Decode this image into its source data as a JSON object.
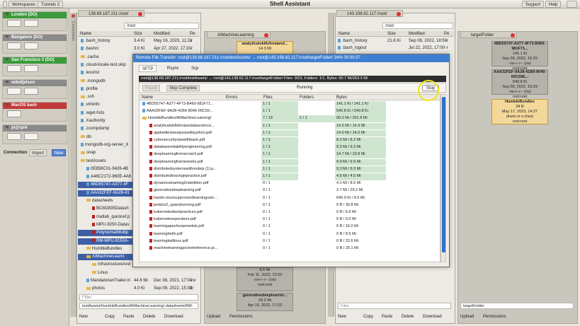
{
  "app": {
    "title": "Shell Assistant",
    "menu": [
      "Workspaces",
      "Tunnels 2"
    ],
    "right_menu": [
      "Support",
      "Help"
    ]
  },
  "connections": [
    {
      "name": "London (DO)",
      "color": "#3b9a3b"
    },
    {
      "name": "Bangalore (DO)",
      "color": "#8a8a8a"
    },
    {
      "name": "San Francisco 3 (DO)",
      "color": "#3b9a3b"
    },
    {
      "name": "mikefjetson",
      "color": "#8a8a8a"
    },
    {
      "name": "MacOS bash",
      "color": "#c23a3a"
    },
    {
      "name": "pi@rpi4",
      "color": "#8a8a8a"
    }
  ],
  "connection_bar": {
    "label": "Connection",
    "import": "Import",
    "new": "New"
  },
  "vertical_tab": "Connections",
  "left_panel": {
    "tab": "138.68.187.211:/root/",
    "path": "/root",
    "columns": [
      "Name",
      "Size",
      "Modified",
      "Pe"
    ],
    "rows": [
      {
        "name": ".bash_history",
        "size": "3.4 Ki",
        "mod": "May 16, 2023, 11:21",
        "pe": "-r",
        "type": "file"
      },
      {
        "name": ".bashrc",
        "size": "3.0 Ki",
        "mod": "Apr 27, 2022, 17:20",
        "pe": "-r",
        "type": "file"
      },
      {
        "name": ".cache",
        "size": "",
        "mod": "",
        "pe": "",
        "type": "folder"
      },
      {
        "name": ".cloud-locale-test.skip",
        "size": "",
        "mod": "",
        "pe": "",
        "type": "file"
      },
      {
        "name": ".lesshst",
        "size": "",
        "mod": "",
        "pe": "",
        "type": "file"
      },
      {
        "name": ".mongodb",
        "size": "",
        "mod": "",
        "pe": "",
        "type": "folder"
      },
      {
        "name": ".profile",
        "size": "",
        "mod": "",
        "pe": "",
        "type": "file"
      },
      {
        "name": ".ssh",
        "size": "",
        "mod": "",
        "pe": "",
        "type": "folder"
      },
      {
        "name": ".viminfo",
        "size": "",
        "mod": "",
        "pe": "",
        "type": "file"
      },
      {
        "name": ".wget-hsts",
        "size": "",
        "mod": "",
        "pe": "",
        "type": "file"
      },
      {
        "name": ".Xauthority",
        "size": "",
        "mod": "",
        "pe": "",
        "type": "file"
      },
      {
        "name": ".zcompdump",
        "size": "",
        "mod": "",
        "pe": "",
        "type": "file"
      },
      {
        "name": "db",
        "size": "",
        "mod": "",
        "pe": "",
        "type": "folder"
      },
      {
        "name": "mongodb-org-server_6",
        "size": "",
        "mod": "",
        "pe": "",
        "type": "file"
      },
      {
        "name": "snap",
        "size": "",
        "mod": "",
        "pe": "",
        "type": "folder"
      },
      {
        "name": "testAssets",
        "size": "",
        "mod": "",
        "pe": "",
        "type": "folder"
      },
      {
        "name": "0E858C01-9426-4B",
        "size": "",
        "mod": "",
        "pe": "",
        "type": "file"
      },
      {
        "name": "A48C2172-860E-4A6",
        "size": "",
        "mod": "",
        "pe": "",
        "type": "file"
      },
      {
        "name": "4BD55747-A377-4F",
        "size": "",
        "mod": "",
        "pe": "",
        "type": "file"
      },
      {
        "name": "AAA32FEF-9A28-41",
        "size": "",
        "mod": "",
        "pe": "",
        "type": "file"
      },
      {
        "name": "datasheets",
        "size": "",
        "mod": "",
        "pe": "",
        "type": "folder"
      },
      {
        "name": "BCM2835Datash",
        "size": "",
        "mod": "",
        "pe": "",
        "type": "pdf"
      },
      {
        "name": "matlab_quickref.p",
        "size": "",
        "mod": "",
        "pe": "",
        "type": "pdf"
      },
      {
        "name": "MPU-9250-Datas",
        "size": "",
        "mod": "",
        "pe": "",
        "type": "pdf"
      },
      {
        "name": "PolynomialMultip",
        "size": "",
        "mod": "",
        "pe": "",
        "type": "pdf"
      },
      {
        "name": "RM-MPU-9150A-",
        "size": "",
        "mod": "",
        "pe": "",
        "type": "pdf"
      },
      {
        "name": "HumbleBundles",
        "size": "",
        "mod": "",
        "pe": "",
        "type": "folder"
      },
      {
        "name": "AIMachineLearni",
        "size": "",
        "mod": "",
        "pe": "",
        "type": "folder"
      },
      {
        "name": "InfrastructureAnd",
        "size": "",
        "mod": "",
        "pe": "",
        "type": "folder"
      },
      {
        "name": "Linux",
        "size": "",
        "mod": "",
        "pe": "",
        "type": "folder"
      },
      {
        "name": "MandalorianTrailer.m",
        "size": "44.6 Mi",
        "mod": "Dec 08, 2021, 17:00",
        "pe": "-rw",
        "type": "file"
      },
      {
        "name": "photos",
        "size": "4.0 Ki",
        "mod": "Sep 09, 2022, 15:31",
        "pe": "dr",
        "type": "folder"
      }
    ],
    "filter_placeholder": "Filter",
    "status": "testAssets/HumbleBundles/AIMachineLearning/.datasheets/RM-",
    "buttons": [
      "New",
      "Copy",
      "Paste",
      "Delete",
      "Download",
      "Upload",
      "Permissions"
    ]
  },
  "middle_panel": {
    "tab": "AIMachineLearning",
    "cards": [
      {
        "name": "analyticalskillsforaiand...",
        "size": "14.3 Mi"
      },
      {
        "name": "",
        "size": "8.5 Mi",
        "date": "Feb 11, 2022, 23:20",
        "perms": "-rw-r--r-- (rw)",
        "owner": "root:root"
      },
      {
        "name": "generativedeeplearnin...",
        "size": "29.2 Mi",
        "date": "Apr 16, 2022, 17:23",
        "perms": "",
        "owner": ""
      }
    ]
  },
  "right_panel": {
    "tab": "143.198.62.117:/root/",
    "path": "/root",
    "columns": [
      "Name",
      "Size",
      "Modified",
      "Pe"
    ],
    "rows": [
      {
        "name": ".bash_history",
        "size": "21.6 Ki",
        "mod": "Sep 08, 2022, 18:50",
        "pe": "-r",
        "type": "file"
      },
      {
        "name": ".bash_logout",
        "size": "",
        "mod": "Jul 22, 2022, 17:00",
        "pe": "-r",
        "type": "file"
      }
    ],
    "target_tab": "targetFolder",
    "target_cards": [
      {
        "name": "4BD55747-A377-4F73-B460-981F71...",
        "size": "141.1 Ki",
        "date": "Sep 09, 2022, 15:29",
        "perms": "-rw-r--r-- (rw)",
        "owner": "root:root"
      },
      {
        "name": "AAA32FEF-9A28-41B9-8040-00C59E...",
        "size": "540.8 Ki",
        "date": "Sep 09, 2022, 15:29",
        "perms": "-rw-r--r-- (rw)",
        "owner": "root:root"
      },
      {
        "name": "HumbleBundles",
        "size": "34 B",
        "date": "May 17, 2023, 14:27",
        "perms": "drwxr-xr-x (rwx)",
        "owner": "root:root"
      }
    ],
    "filter_placeholder": "Filter",
    "target_field": "targetFolder",
    "buttons": [
      "New",
      "Copy",
      "Paste",
      "Delete",
      "Download",
      "Upload",
      "Permissions"
    ]
  },
  "dialog": {
    "title": "Remote File Transfer: root@138.68.187.211:/root/testAssets/ → root@143.198.62.117:/root/targetFolder/ 34% 00:00:37",
    "tabs": [
      "SFTP",
      "Rsync",
      "Scp"
    ],
    "banner": "root@138.68.187.211:/root/testAssets/ → root@143.198.62.117:/root/targetFolder/ Files: 9/23, Folders: 1/1, Bytes: 90.7 Mi/263.3 Mi",
    "pause": "Pause",
    "skip": "Skip Complete",
    "state": "Running",
    "stop": "Stop",
    "columns": [
      "Name",
      "Errors",
      "Files",
      "Folders",
      "Bytes"
    ],
    "rows": [
      {
        "name": "4BD55747-A377-4F73-B460-981F71...",
        "files": "1 / 1",
        "folders": "",
        "bytes": "141.1 Ki / 141.1 Ki",
        "type": "file",
        "indent": 1,
        "done": true
      },
      {
        "name": "AAA32FEF-9A28-41B9-8040-00C59...",
        "files": "1 / 1",
        "folders": "",
        "bytes": "540.8 Ki / 540.8 Ki",
        "type": "file",
        "indent": 1,
        "done": true
      },
      {
        "name": "HumbleBundles/AIMachineLearning/",
        "files": "7 / 19",
        "folders": "1 / 1",
        "bytes": "90.0 Mi / 261.8 Mi",
        "type": "folder",
        "indent": 1,
        "done": true
      },
      {
        "name": "analyticalskillsforaiandatascience...",
        "files": "1 / 1",
        "folders": "",
        "bytes": "14.3 Mi / 14.3 Mi",
        "type": "pdf",
        "indent": 2,
        "done": true
      },
      {
        "name": "appliedtextanalysiswithpython.pdf",
        "files": "1 / 1",
        "folders": "",
        "bytes": "14.0 Mi / 14.0 Mi",
        "type": "pdf",
        "indent": 2,
        "done": true
      },
      {
        "name": "cybersecurityopswithbash.pdf",
        "files": "1 / 1",
        "folders": "",
        "bytes": "8.2 Mi / 8.2 Mi",
        "type": "pdf",
        "indent": 2,
        "done": true
      },
      {
        "name": "databasereliabilityengineering.pdf",
        "files": "1 / 1",
        "folders": "",
        "bytes": "9.3 Mi / 9.3 Mi",
        "type": "pdf",
        "indent": 2,
        "done": true
      },
      {
        "name": "deeplearningfromscratch.pdf",
        "files": "1 / 1",
        "folders": "",
        "bytes": "14.7 Mi / 23.8 Mi",
        "type": "pdf",
        "indent": 2,
        "done": true
      },
      {
        "name": "deeplearningframeworks.pdf",
        "files": "1 / 1",
        "folders": "",
        "bytes": "9.9 Mi / 9.9 Mi",
        "type": "pdf",
        "indent": 2,
        "done": true
      },
      {
        "name": "distributedsystemswithnodejs (1).p...",
        "files": "1 / 1",
        "folders": "",
        "bytes": "9.3 Mi / 9.3 Mi",
        "type": "pdf",
        "indent": 2,
        "done": true
      },
      {
        "name": "distributedtracinginpractice.pdf",
        "files": "1 / 1",
        "folders": "",
        "bytes": "4.5 Mi / 4.5 Mi",
        "type": "pdf",
        "indent": 2,
        "done": true
      },
      {
        "name": "dynamicsteaming2ndedition.pdf",
        "files": "0 / 1",
        "folders": "",
        "bytes": "4.1 Mi / 8.5 Mi",
        "type": "pdf",
        "indent": 2,
        "done": false
      },
      {
        "name": "generativedeeplearning.pdf",
        "files": "0 / 1",
        "folders": "",
        "bytes": "2.7 Mi / 29.2 Mi",
        "type": "pdf",
        "indent": 2,
        "done": false
      },
      {
        "name": "hands-onunsupervisedlearningusin...",
        "files": "0 / 1",
        "folders": "",
        "bytes": "640.0 Ki / 8.6 Mi",
        "type": "pdf",
        "indent": 2,
        "done": false
      },
      {
        "name": "jenkins2_upandrunning.pdf",
        "files": "0 / 1",
        "folders": "",
        "bytes": "0 B / 30.8 Mi",
        "type": "pdf",
        "indent": 2,
        "done": false
      },
      {
        "name": "kubernetesbestpractices.pdf",
        "files": "0 / 1",
        "folders": "",
        "bytes": "0 B / 6.6 Mi",
        "type": "pdf",
        "indent": 2,
        "done": false
      },
      {
        "name": "kubernetesoperators.pdf",
        "files": "0 / 1",
        "folders": "",
        "bytes": "0 B / 5.0 Mi",
        "type": "pdf",
        "indent": 2,
        "done": false
      },
      {
        "name": "learningapachespenwtisk.pdf",
        "files": "0 / 1",
        "folders": "",
        "bytes": "0 B / 16.0 Mi",
        "type": "pdf",
        "indent": 2,
        "done": false
      },
      {
        "name": "learninghelm.pdf",
        "files": "0 / 1",
        "folders": "",
        "bytes": "0 B / 8.9 Mi",
        "type": "pdf",
        "indent": 2,
        "done": false
      },
      {
        "name": "learningkalilinux.pdf",
        "files": "0 / 1",
        "folders": "",
        "bytes": "0 B / 22.6 Mi",
        "type": "pdf",
        "indent": 2,
        "done": false
      },
      {
        "name": "machinelearningpocketreference.pi...",
        "files": "0 / 1",
        "folders": "",
        "bytes": "0 B / 25.1 Mi",
        "type": "pdf",
        "indent": 2,
        "done": false
      }
    ]
  }
}
